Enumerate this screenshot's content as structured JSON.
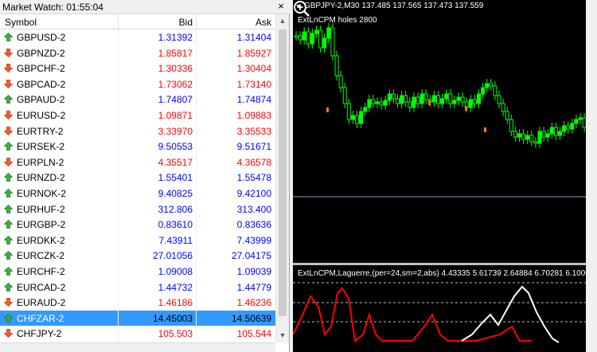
{
  "market_watch": {
    "title": "Market Watch: 01:55:04",
    "close_glyph": "×",
    "columns": {
      "symbol": "Symbol",
      "bid": "Bid",
      "ask": "Ask"
    },
    "rows": [
      {
        "symbol": "GBPUSD-2",
        "bid": "1.31392",
        "ask": "1.31404",
        "dir": "up",
        "color": "#0000ff"
      },
      {
        "symbol": "GBPNZD-2",
        "bid": "1.85817",
        "ask": "1.85927",
        "dir": "down",
        "color": "#ff0000"
      },
      {
        "symbol": "GBPCHF-2",
        "bid": "1.30336",
        "ask": "1.30404",
        "dir": "down",
        "color": "#ff0000"
      },
      {
        "symbol": "GBPCAD-2",
        "bid": "1.73062",
        "ask": "1.73140",
        "dir": "down",
        "color": "#ff0000"
      },
      {
        "symbol": "GBPAUD-2",
        "bid": "1.74807",
        "ask": "1.74874",
        "dir": "up",
        "color": "#0000ff"
      },
      {
        "symbol": "EURUSD-2",
        "bid": "1.09871",
        "ask": "1.09883",
        "dir": "down",
        "color": "#ff0000"
      },
      {
        "symbol": "EURTRY-2",
        "bid": "3.33970",
        "ask": "3.35533",
        "dir": "down",
        "color": "#ff0000"
      },
      {
        "symbol": "EURSEK-2",
        "bid": "9.50553",
        "ask": "9.51671",
        "dir": "up",
        "color": "#0000ff"
      },
      {
        "symbol": "EURPLN-2",
        "bid": "4.35517",
        "ask": "4.36578",
        "dir": "down",
        "color": "#ff0000"
      },
      {
        "symbol": "EURNZD-2",
        "bid": "1.55401",
        "ask": "1.55478",
        "dir": "up",
        "color": "#0000ff"
      },
      {
        "symbol": "EURNOK-2",
        "bid": "9.40825",
        "ask": "9.42100",
        "dir": "up",
        "color": "#0000ff"
      },
      {
        "symbol": "EURHUF-2",
        "bid": "312.806",
        "ask": "313.400",
        "dir": "up",
        "color": "#0000ff"
      },
      {
        "symbol": "EURGBP-2",
        "bid": "0.83610",
        "ask": "0.83636",
        "dir": "up",
        "color": "#0000ff"
      },
      {
        "symbol": "EURDKK-2",
        "bid": "7.43911",
        "ask": "7.43999",
        "dir": "up",
        "color": "#0000ff"
      },
      {
        "symbol": "EURCZK-2",
        "bid": "27.01056",
        "ask": "27.04175",
        "dir": "up",
        "color": "#0000ff"
      },
      {
        "symbol": "EURCHF-2",
        "bid": "1.09008",
        "ask": "1.09039",
        "dir": "up",
        "color": "#0000ff"
      },
      {
        "symbol": "EURCAD-2",
        "bid": "1.44732",
        "ask": "1.44779",
        "dir": "up",
        "color": "#0000ff"
      },
      {
        "symbol": "EURAUD-2",
        "bid": "1.46186",
        "ask": "1.46236",
        "dir": "down",
        "color": "#ff0000"
      },
      {
        "symbol": "CHFZAR-2",
        "bid": "14.45003",
        "ask": "14.50639",
        "dir": "up",
        "color": "#000000",
        "selected": true
      },
      {
        "symbol": "CHFJPY-2",
        "bid": "105.503",
        "ask": "105.544",
        "dir": "down",
        "color": "#ff0000"
      }
    ]
  },
  "chart": {
    "symbol_info": "GBPJPY-2,M30  137.485 137.565 137.473 137.559",
    "indicator_label": "ExtLnCPM holes 2800",
    "subwindow_label": "ExtLnCPM,Laguerre,(per=24,sm=2,abs) 4.43335 5.61739 2.64884 6.70281 6.10006 8.3406",
    "zoom_icon": "zoom-in-icon",
    "colors": {
      "bull": "#00ff00",
      "bear": "#00ff00",
      "red_line": "#ff0000",
      "white_line": "#ffffff",
      "marker": "#ff8000"
    }
  }
}
